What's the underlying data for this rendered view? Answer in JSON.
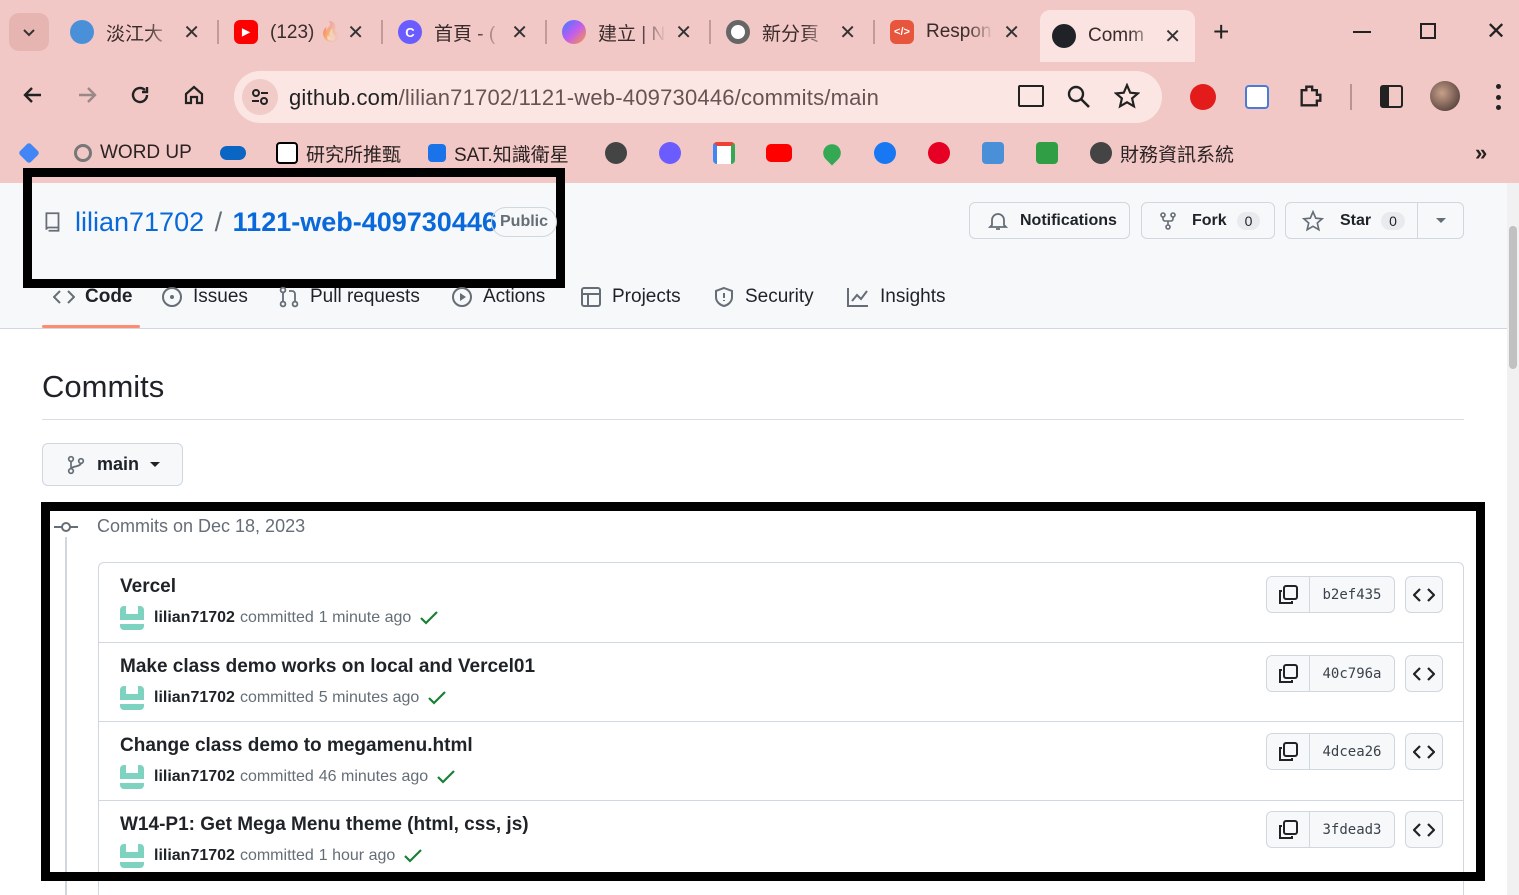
{
  "browser": {
    "tabs": [
      {
        "title": "淡江大",
        "icon_color": "#4a90d9",
        "icon": "tku-icon"
      },
      {
        "title": "(123) 🔥",
        "icon_color": "#ff0000",
        "icon": "youtube-icon"
      },
      {
        "title": "首頁 - (",
        "icon_color": "#6a5cff",
        "icon": "canva-icon"
      },
      {
        "title": "建立 | N",
        "icon_color": "#8c6cf0",
        "icon": "copilot-icon"
      },
      {
        "title": "新分頁",
        "icon_color": "#666666",
        "icon": "chrome-icon"
      },
      {
        "title": "Respon",
        "icon_color": "#e8553d",
        "icon": "code-icon"
      },
      {
        "title": "Comm",
        "icon_color": "#1f2328",
        "icon": "github-icon"
      }
    ],
    "url_host": "github.com",
    "url_path": "/lilian71702/1121-web-409730446/commits/main",
    "bookmarks": [
      {
        "label": "",
        "color": "#4285f4"
      },
      {
        "label": "WORD UP",
        "color": "#888888"
      },
      {
        "label": "",
        "color": "#0a66c2"
      },
      {
        "label": "研究所推甄",
        "color": "#000000"
      },
      {
        "label": "SAT.知識衛星",
        "color": "#1a73e8"
      },
      {
        "label": "",
        "color": "#444444"
      },
      {
        "label": "",
        "color": "#6a5cff"
      },
      {
        "label": "",
        "color": "#ea4335"
      },
      {
        "label": "",
        "color": "#ff0000"
      },
      {
        "label": "",
        "color": "#34a853"
      },
      {
        "label": "",
        "color": "#1877f2"
      },
      {
        "label": "",
        "color": "#e60023"
      },
      {
        "label": "",
        "color": "#4a90d9"
      },
      {
        "label": "",
        "color": "#2f9e44"
      },
      {
        "label": "財務資訊系統",
        "color": "#444444"
      }
    ]
  },
  "repo": {
    "owner": "lilian71702",
    "separator": "/",
    "name": "1121-web-409730446",
    "visibility": "Public",
    "notifications_label": "Notifications",
    "fork_label": "Fork",
    "fork_count": "0",
    "star_label": "Star",
    "star_count": "0"
  },
  "nav": [
    "Code",
    "Issues",
    "Pull requests",
    "Actions",
    "Projects",
    "Security",
    "Insights"
  ],
  "page": {
    "title": "Commits",
    "branch": "main",
    "group_label": "Commits on Dec 18, 2023"
  },
  "commits": [
    {
      "message": "Vercel",
      "author": "lilian71702",
      "verb": "committed",
      "time": "1 minute ago",
      "sha": "b2ef435"
    },
    {
      "message": "Make class demo works on local and Vercel01",
      "author": "lilian71702",
      "verb": "committed",
      "time": "5 minutes ago",
      "sha": "40c796a"
    },
    {
      "message": "Change class demo to megamenu.html",
      "author": "lilian71702",
      "verb": "committed",
      "time": "46 minutes ago",
      "sha": "4dcea26"
    },
    {
      "message": "W14-P1: Get Mega Menu theme (html, css, js)",
      "author": "lilian71702",
      "verb": "committed",
      "time": "1 hour ago",
      "sha": "3fdead3"
    }
  ],
  "colors": {
    "link": "#0969da",
    "success": "#1a7f37",
    "accent_underline": "#fd8c73"
  }
}
